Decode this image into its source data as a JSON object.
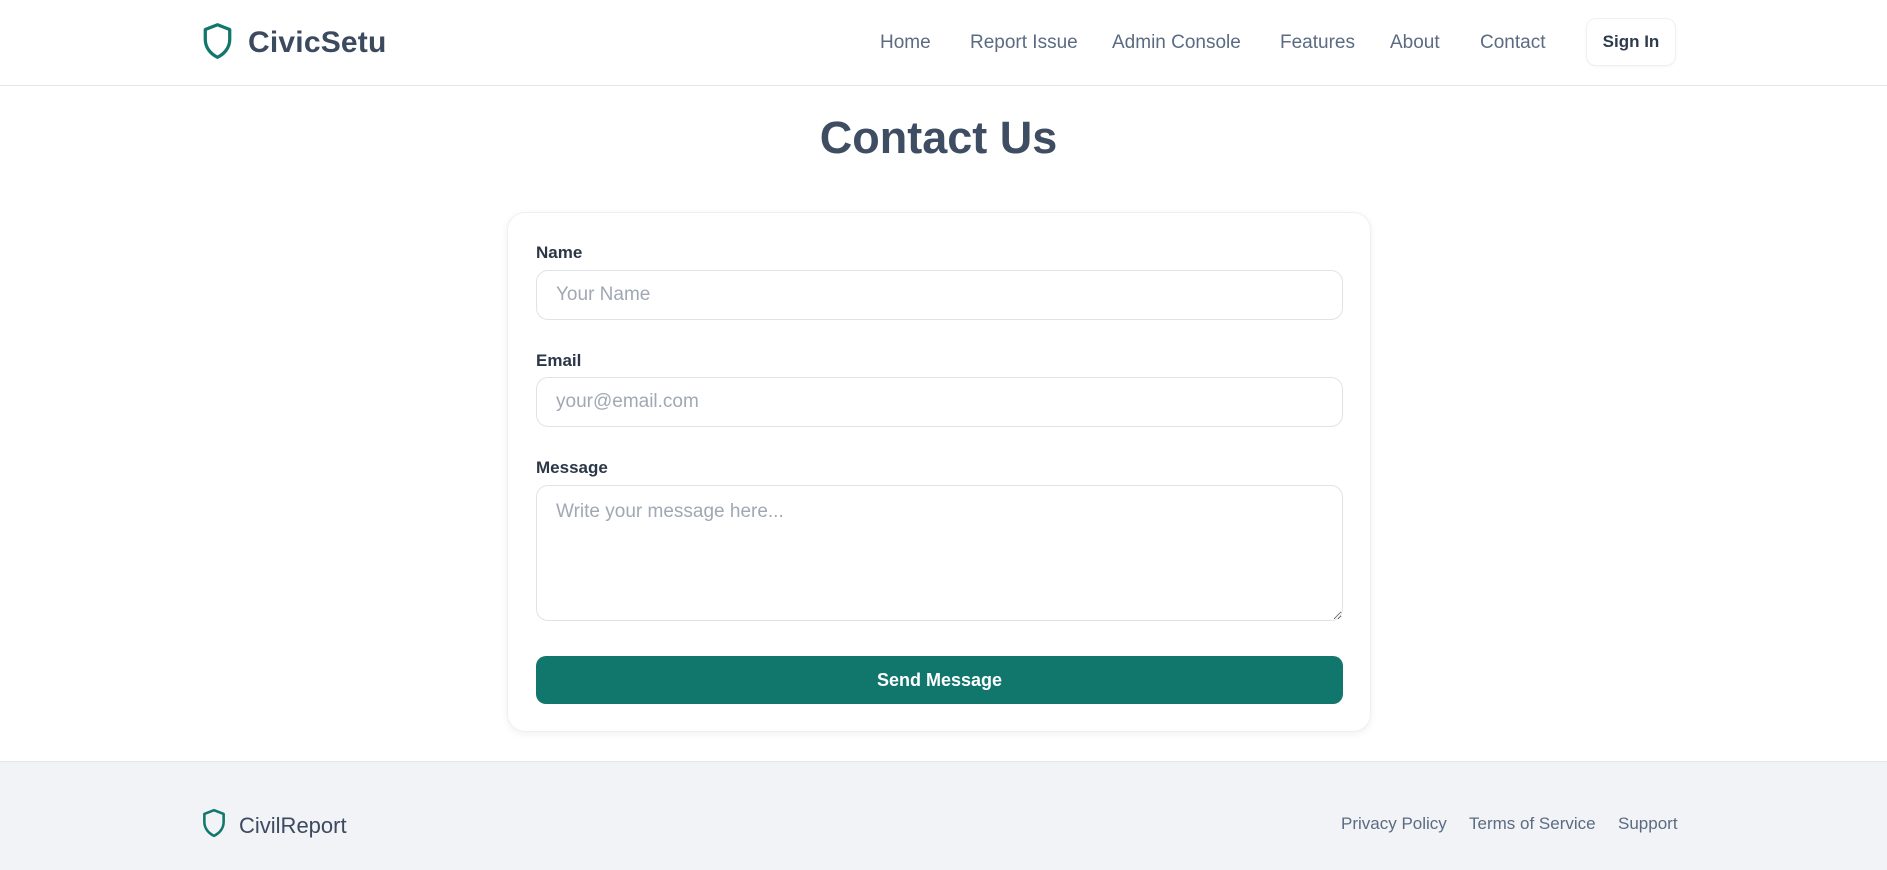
{
  "header": {
    "brand": "CivicSetu",
    "nav": [
      "Home",
      "Report Issue",
      "Admin Console",
      "Features",
      "About",
      "Contact"
    ],
    "sign_in": "Sign In"
  },
  "main": {
    "title": "Contact Us",
    "form": {
      "name_label": "Name",
      "name_placeholder": "Your Name",
      "email_label": "Email",
      "email_placeholder": "your@email.com",
      "message_label": "Message",
      "message_placeholder": "Write your message here...",
      "submit": "Send Message"
    }
  },
  "footer": {
    "brand": "CivilReport",
    "links": [
      "Privacy Policy",
      "Terms of Service",
      "Support"
    ]
  },
  "colors": {
    "accent": "#11776d",
    "text_dark": "#3b4a5f",
    "footer_bg": "#f1f3f6"
  },
  "icons": {
    "logo": "shield-icon"
  }
}
